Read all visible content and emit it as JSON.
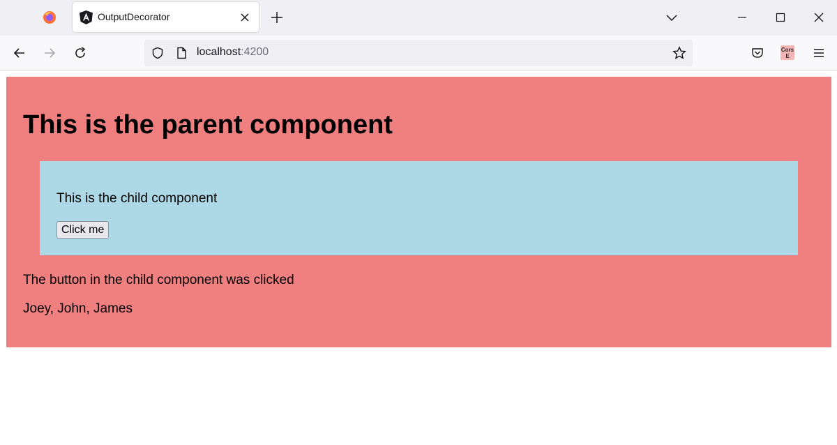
{
  "browser": {
    "tab": {
      "title": "OutputDecorator"
    },
    "address": {
      "host": "localhost",
      "port": ":4200"
    },
    "extension_label_top": "Cors",
    "extension_label_bottom": "E",
    "colors": {
      "tabstrip": "#f0f0f4",
      "navbar": "#f9f9fb"
    }
  },
  "page": {
    "parent": {
      "title": "This is the parent component",
      "status": "The button in the child component was clicked",
      "names": "Joey, John, James",
      "color": "#f08080"
    },
    "child": {
      "text": "This is the child component",
      "button_label": "Click me",
      "color": "#add8e6"
    }
  },
  "icons": [
    "firefox-logo-icon",
    "angular-favicon-icon",
    "close-tab-icon",
    "new-tab-icon",
    "tab-list-chevron-icon",
    "minimize-icon",
    "maximize-icon",
    "close-window-icon",
    "back-arrow-icon",
    "forward-arrow-icon",
    "reload-icon",
    "shield-icon",
    "page-icon",
    "bookmark-star-icon",
    "pocket-icon",
    "cors-extension-icon",
    "hamburger-menu-icon"
  ]
}
